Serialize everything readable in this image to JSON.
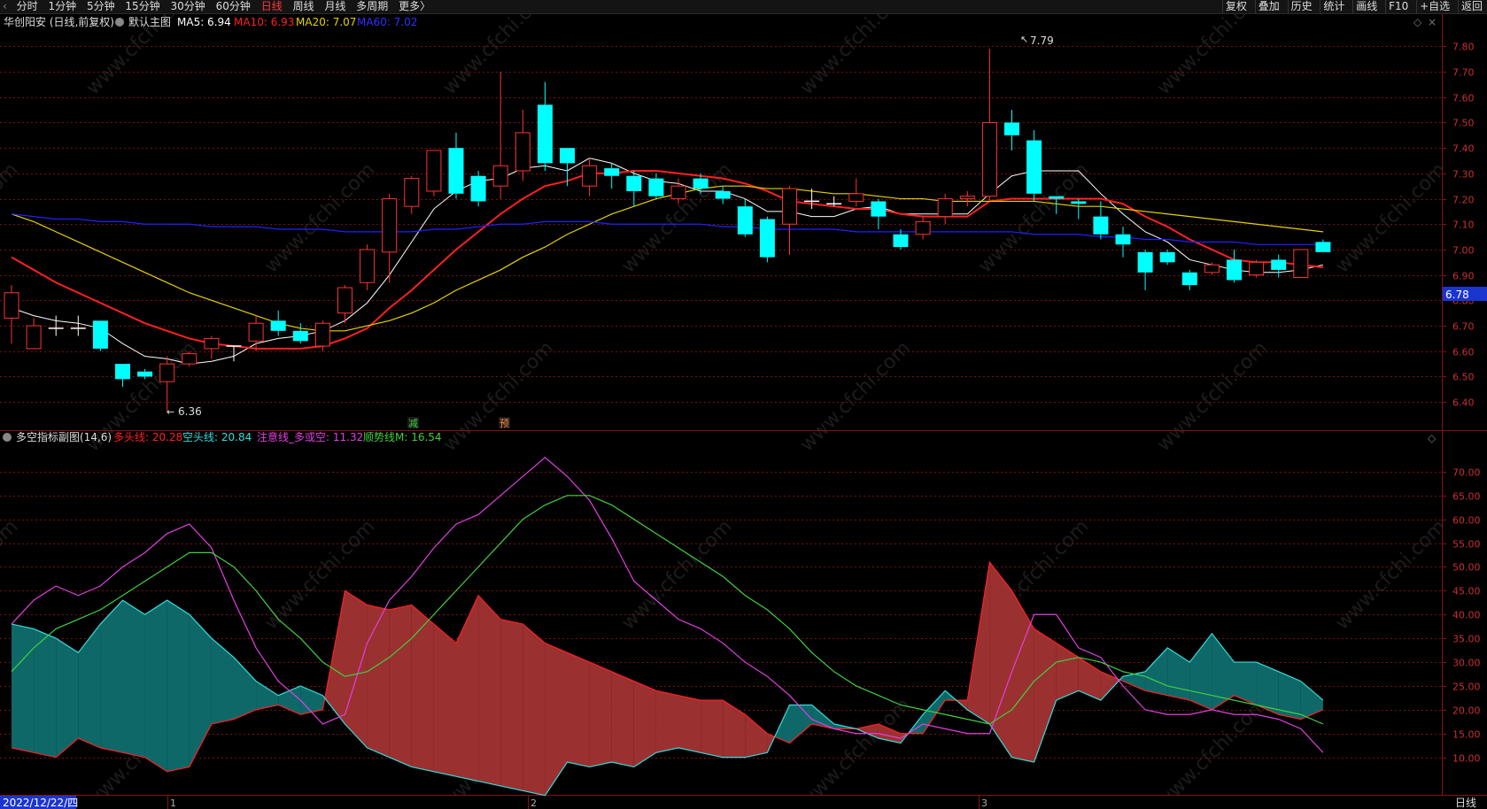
{
  "topbar": {
    "back_icon": "back-arrow-icon",
    "periods": [
      "分时",
      "1分钟",
      "5分钟",
      "15分钟",
      "30分钟",
      "60分钟",
      "日线",
      "周线",
      "月线",
      "多周期",
      "更多〉"
    ],
    "active_period": "日线",
    "tools": [
      "复权",
      "叠加",
      "历史",
      "统计",
      "画线",
      "F10",
      "+自选",
      "返回"
    ]
  },
  "main_legend": {
    "stock": "华创阳安 (日线,前复权)",
    "chart_name": "默认主图",
    "ma5": "MA5: 6.94",
    "ma10": "MA10: 6.93",
    "ma20": "MA20: 7.07",
    "ma60": "MA60: 7.02"
  },
  "sub_legend": {
    "name": "多空指标副图(14,6)",
    "duo": "多头线: 20.28",
    "kong": "空头线: 20.84",
    "zhuyi": "注意线_多或空: 11.32",
    "shunshi": "顺势线M: 16.54"
  },
  "annotations": {
    "high": "7.79",
    "low": "6.36",
    "price_tag": "6.78",
    "marker_jian": "减",
    "marker_yu": "预"
  },
  "bottom": {
    "date": "2022/12/22/四",
    "month_1": "1",
    "month_2": "2",
    "month_3": "3",
    "period_tab": "日线"
  },
  "colors": {
    "up": "#ff3232",
    "down": "#00ffff",
    "ma5": "#ffffff",
    "ma10": "#ff2020",
    "ma20": "#e6d200",
    "ma60": "#2020ff",
    "duo": "#ff2020",
    "kong": "#33dddd",
    "zhuyi": "#e040e0",
    "shunshi": "#40d040",
    "grid": "#7a1010"
  },
  "chart_data": [
    {
      "type": "candlestick",
      "title": "华创阳安 (日线,前复权)",
      "ylim": [
        6.31,
        7.85
      ],
      "y_ticks": [
        6.4,
        6.5,
        6.6,
        6.7,
        6.8,
        6.9,
        7.0,
        7.1,
        7.2,
        7.3,
        7.4,
        7.5,
        7.6,
        7.7,
        7.8
      ],
      "candles": [
        [
          6.73,
          6.83,
          6.63,
          6.86
        ],
        [
          6.61,
          6.7,
          6.61,
          6.73
        ],
        [
          6.69,
          6.69,
          6.66,
          6.74
        ],
        [
          6.69,
          6.69,
          6.66,
          6.74
        ],
        [
          6.72,
          6.61,
          6.6,
          6.72
        ],
        [
          6.55,
          6.49,
          6.46,
          6.55
        ],
        [
          6.52,
          6.5,
          6.49,
          6.53
        ],
        [
          6.48,
          6.55,
          6.36,
          6.58
        ],
        [
          6.55,
          6.59,
          6.54,
          6.6
        ],
        [
          6.61,
          6.65,
          6.57,
          6.66
        ],
        [
          6.62,
          6.62,
          6.56,
          6.62
        ],
        [
          6.64,
          6.71,
          6.6,
          6.74
        ],
        [
          6.72,
          6.68,
          6.66,
          6.76
        ],
        [
          6.68,
          6.64,
          6.63,
          6.71
        ],
        [
          6.62,
          6.71,
          6.6,
          6.72
        ],
        [
          6.75,
          6.85,
          6.71,
          6.86
        ],
        [
          6.87,
          7.0,
          6.84,
          7.02
        ],
        [
          6.99,
          7.2,
          6.87,
          7.22
        ],
        [
          7.17,
          7.28,
          7.14,
          7.29
        ],
        [
          7.23,
          7.39,
          7.21,
          7.39
        ],
        [
          7.4,
          7.22,
          7.2,
          7.46
        ],
        [
          7.29,
          7.19,
          7.17,
          7.31
        ],
        [
          7.25,
          7.33,
          7.2,
          7.7
        ],
        [
          7.31,
          7.46,
          7.27,
          7.55
        ],
        [
          7.57,
          7.34,
          7.31,
          7.66
        ],
        [
          7.4,
          7.34,
          7.25,
          7.4
        ],
        [
          7.25,
          7.33,
          7.21,
          7.36
        ],
        [
          7.32,
          7.29,
          7.24,
          7.34
        ],
        [
          7.29,
          7.23,
          7.17,
          7.31
        ],
        [
          7.28,
          7.21,
          7.2,
          7.3
        ],
        [
          7.2,
          7.25,
          7.18,
          7.28
        ],
        [
          7.28,
          7.24,
          7.22,
          7.3
        ],
        [
          7.23,
          7.2,
          7.18,
          7.25
        ],
        [
          7.17,
          7.06,
          7.05,
          7.2
        ],
        [
          7.12,
          6.97,
          6.95,
          7.13
        ],
        [
          7.1,
          7.24,
          6.98,
          7.25
        ],
        [
          7.19,
          7.19,
          7.16,
          7.24
        ],
        [
          7.18,
          7.18,
          7.17,
          7.21
        ],
        [
          7.19,
          7.22,
          7.17,
          7.28
        ],
        [
          7.19,
          7.13,
          7.08,
          7.2
        ],
        [
          7.06,
          7.01,
          7.0,
          7.08
        ],
        [
          7.06,
          7.11,
          7.04,
          7.13
        ],
        [
          7.13,
          7.2,
          7.1,
          7.22
        ],
        [
          7.2,
          7.21,
          7.17,
          7.23
        ],
        [
          7.21,
          7.5,
          7.19,
          7.79
        ],
        [
          7.5,
          7.45,
          7.39,
          7.55
        ],
        [
          7.43,
          7.22,
          7.19,
          7.47
        ],
        [
          7.21,
          7.2,
          7.14,
          7.21
        ],
        [
          7.19,
          7.18,
          7.12,
          7.2
        ],
        [
          7.13,
          7.06,
          7.04,
          7.19
        ],
        [
          7.06,
          7.02,
          6.97,
          7.09
        ],
        [
          6.99,
          6.91,
          6.84,
          7.0
        ],
        [
          6.99,
          6.95,
          6.94,
          7.0
        ],
        [
          6.91,
          6.86,
          6.84,
          6.92
        ],
        [
          6.91,
          6.94,
          6.9,
          6.95
        ],
        [
          6.96,
          6.88,
          6.87,
          7.0
        ],
        [
          6.9,
          6.95,
          6.89,
          6.96
        ],
        [
          6.96,
          6.92,
          6.89,
          6.98
        ],
        [
          6.89,
          7.0,
          6.89,
          7.0
        ],
        [
          7.03,
          6.99,
          6.99,
          7.04
        ]
      ],
      "series": [
        {
          "name": "MA5",
          "values": [
            6.77,
            6.74,
            6.72,
            6.71,
            6.69,
            6.63,
            6.58,
            6.57,
            6.55,
            6.56,
            6.58,
            6.63,
            6.65,
            6.66,
            6.68,
            6.72,
            6.79,
            6.9,
            7.03,
            7.16,
            7.23,
            7.27,
            7.28,
            7.32,
            7.33,
            7.31,
            7.36,
            7.34,
            7.3,
            7.27,
            7.26,
            7.23,
            7.23,
            7.2,
            7.15,
            7.15,
            7.13,
            7.13,
            7.16,
            7.17,
            7.14,
            7.14,
            7.14,
            7.14,
            7.22,
            7.29,
            7.31,
            7.31,
            7.31,
            7.22,
            7.14,
            7.07,
            7.03,
            6.96,
            6.94,
            6.92,
            6.91,
            6.91,
            6.92,
            6.94
          ]
        },
        {
          "name": "MA10",
          "values": [
            6.97,
            6.92,
            6.87,
            6.83,
            6.79,
            6.75,
            6.71,
            6.68,
            6.65,
            6.63,
            6.62,
            6.61,
            6.61,
            6.61,
            6.62,
            6.65,
            6.69,
            6.77,
            6.84,
            6.92,
            7.0,
            7.07,
            7.14,
            7.2,
            7.25,
            7.27,
            7.3,
            7.3,
            7.31,
            7.31,
            7.3,
            7.29,
            7.28,
            7.26,
            7.23,
            7.19,
            7.18,
            7.17,
            7.16,
            7.16,
            7.14,
            7.13,
            7.13,
            7.13,
            7.19,
            7.2,
            7.2,
            7.2,
            7.2,
            7.2,
            7.18,
            7.13,
            7.09,
            7.04,
            7.0,
            6.96,
            6.95,
            6.95,
            6.94,
            6.93
          ]
        },
        {
          "name": "MA20",
          "values": [
            7.14,
            7.11,
            7.07,
            7.03,
            6.99,
            6.95,
            6.91,
            6.87,
            6.83,
            6.8,
            6.77,
            6.74,
            6.71,
            6.69,
            6.68,
            6.68,
            6.7,
            6.72,
            6.75,
            6.79,
            6.84,
            6.88,
            6.92,
            6.97,
            7.01,
            7.06,
            7.1,
            7.14,
            7.17,
            7.2,
            7.22,
            7.24,
            7.25,
            7.25,
            7.24,
            7.24,
            7.23,
            7.22,
            7.22,
            7.21,
            7.2,
            7.2,
            7.19,
            7.19,
            7.19,
            7.19,
            7.19,
            7.18,
            7.17,
            7.17,
            7.16,
            7.15,
            7.14,
            7.13,
            7.12,
            7.11,
            7.1,
            7.09,
            7.08,
            7.07
          ]
        },
        {
          "name": "MA60",
          "values": [
            7.14,
            7.13,
            7.12,
            7.12,
            7.11,
            7.11,
            7.1,
            7.1,
            7.1,
            7.09,
            7.09,
            7.09,
            7.08,
            7.08,
            7.08,
            7.07,
            7.07,
            7.07,
            7.07,
            7.08,
            7.08,
            7.09,
            7.1,
            7.1,
            7.11,
            7.11,
            7.11,
            7.1,
            7.1,
            7.1,
            7.1,
            7.1,
            7.09,
            7.09,
            7.08,
            7.08,
            7.08,
            7.08,
            7.07,
            7.07,
            7.07,
            7.07,
            7.07,
            7.07,
            7.07,
            7.07,
            7.06,
            7.06,
            7.06,
            7.05,
            7.05,
            7.04,
            7.04,
            7.03,
            7.03,
            7.03,
            7.02,
            7.02,
            7.02,
            7.02
          ]
        }
      ]
    },
    {
      "type": "line",
      "title": "多空指标副图(14,6)",
      "ylim": [
        2.5,
        75
      ],
      "y_ticks": [
        10,
        15,
        20,
        25,
        30,
        35,
        40,
        45,
        50,
        55,
        60,
        65,
        70
      ],
      "series": [
        {
          "name": "多头线",
          "values": [
            12,
            11,
            10,
            14,
            12,
            11,
            10,
            7,
            8,
            17,
            18,
            20,
            21,
            19,
            20,
            45,
            42,
            41,
            42,
            38,
            34,
            44,
            39,
            38,
            34,
            32,
            30,
            28,
            26,
            24,
            23,
            22,
            22,
            19,
            15,
            13,
            17,
            16,
            16,
            17,
            15,
            15,
            22,
            22,
            51,
            45,
            37,
            34,
            31,
            28,
            26,
            24,
            23,
            22,
            20,
            23,
            21,
            19,
            18,
            20
          ]
        },
        {
          "name": "空头线",
          "values": [
            38,
            37,
            35,
            32,
            38,
            43,
            40,
            43,
            40,
            35,
            31,
            26,
            23,
            25,
            23,
            17,
            12,
            10,
            8,
            7,
            6,
            5,
            4,
            3,
            2,
            9,
            8,
            9,
            8,
            11,
            12,
            11,
            10,
            10,
            11,
            21,
            21,
            17,
            16,
            14,
            13,
            19,
            24,
            20,
            17,
            10,
            9,
            22,
            24,
            22,
            27,
            28,
            33,
            30,
            36,
            30,
            30,
            28,
            26,
            22
          ]
        },
        {
          "name": "注意线_多或空",
          "values": [
            38,
            43,
            46,
            44,
            46,
            50,
            53,
            57,
            59,
            54,
            43,
            33,
            26,
            22,
            17,
            19,
            34,
            43,
            48,
            54,
            59,
            61,
            65,
            69,
            73,
            69,
            64,
            56,
            47,
            43,
            39,
            37,
            34,
            30,
            27,
            23,
            18,
            16,
            15,
            15,
            14,
            17,
            16,
            15,
            15,
            28,
            40,
            40,
            33,
            31,
            25,
            20,
            19,
            19,
            20,
            19,
            19,
            18,
            16,
            11
          ]
        },
        {
          "name": "顺势线M",
          "values": [
            28,
            33,
            37,
            39,
            41,
            44,
            47,
            50,
            53,
            53,
            50,
            45,
            39,
            35,
            30,
            27,
            28,
            31,
            35,
            40,
            45,
            50,
            55,
            60,
            63,
            65,
            65,
            63,
            60,
            57,
            54,
            51,
            48,
            44,
            41,
            37,
            32,
            28,
            25,
            23,
            21,
            20,
            19,
            18,
            17,
            20,
            26,
            30,
            31,
            30,
            28,
            27,
            25,
            24,
            23,
            22,
            21,
            20,
            19,
            17
          ]
        }
      ]
    }
  ]
}
